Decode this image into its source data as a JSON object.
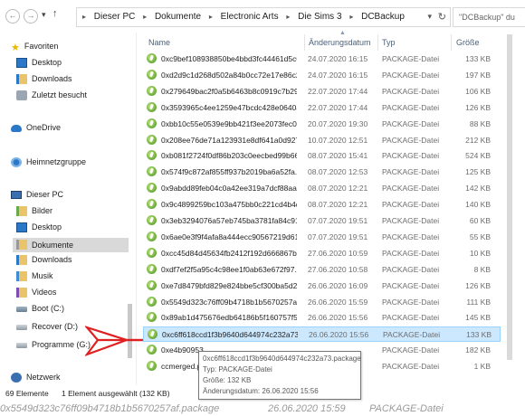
{
  "address_bar": {
    "crumbs": [
      "Dieser PC",
      "Dokumente",
      "Electronic Arts",
      "Die Sims 3",
      "DCBackup"
    ],
    "search_placeholder": "\"DCBackup\" du"
  },
  "sidebar": {
    "items": [
      {
        "label": "Favoriten",
        "icon": "star-icon"
      },
      {
        "label": "Desktop",
        "icon": "desktop-icon"
      },
      {
        "label": "Downloads",
        "icon": "downloads-icon"
      },
      {
        "label": "Zuletzt besucht",
        "icon": "recent-icon"
      },
      {
        "label": "OneDrive",
        "icon": "cloud-icon"
      },
      {
        "label": "Heimnetzgruppe",
        "icon": "homegroup-icon"
      },
      {
        "label": "Dieser PC",
        "icon": "computer-icon"
      },
      {
        "label": "Bilder",
        "icon": "pictures-icon"
      },
      {
        "label": "Desktop",
        "icon": "desktop-icon"
      },
      {
        "label": "Dokumente",
        "icon": "documents-icon"
      },
      {
        "label": "Downloads",
        "icon": "downloads-icon"
      },
      {
        "label": "Musik",
        "icon": "music-icon"
      },
      {
        "label": "Videos",
        "icon": "videos-icon"
      },
      {
        "label": "Boot (C:)",
        "icon": "drive-icon"
      },
      {
        "label": "Recover (D:)",
        "icon": "drive-icon"
      },
      {
        "label": "Programme (G:)",
        "icon": "drive-icon"
      },
      {
        "label": "Netzwerk",
        "icon": "network-icon"
      }
    ]
  },
  "columns": {
    "name": "Name",
    "date": "Änderungsdatum",
    "type": "Typ",
    "size": "Größe"
  },
  "files": [
    {
      "name": "0xc9bef108938850be4bbd3fc44461d5c0...",
      "date": "24.07.2020 16:15",
      "type": "PACKAGE-Datei",
      "size": "133 KB"
    },
    {
      "name": "0xd2d9c1d268d502a84b0cc72e17e86c2a...",
      "date": "24.07.2020 16:15",
      "type": "PACKAGE-Datei",
      "size": "197 KB"
    },
    {
      "name": "0x279649bac2f0a5b6463b8c0919c7b293...",
      "date": "22.07.2020 17:44",
      "type": "PACKAGE-Datei",
      "size": "106 KB"
    },
    {
      "name": "0x3593965c4ee1259e47bcdc428e0640a6...",
      "date": "22.07.2020 17:44",
      "type": "PACKAGE-Datei",
      "size": "126 KB"
    },
    {
      "name": "0xbb10c55e0539e9bb421f3ee2073fec08...",
      "date": "20.07.2020 19:30",
      "type": "PACKAGE-Datei",
      "size": "88 KB"
    },
    {
      "name": "0x208ee76de71a123931e8df641a0d9276...",
      "date": "10.07.2020 12:51",
      "type": "PACKAGE-Datei",
      "size": "212 KB"
    },
    {
      "name": "0xb081f2724f0df86b203c0eecbed99b66...",
      "date": "08.07.2020 15:41",
      "type": "PACKAGE-Datei",
      "size": "524 KB"
    },
    {
      "name": "0x574f9c872af855ff937b2019ba6a52fa.p...",
      "date": "08.07.2020 12:53",
      "type": "PACKAGE-Datei",
      "size": "125 KB"
    },
    {
      "name": "0x9abdd89feb04c0a42ee319a7dcf88aa7...",
      "date": "08.07.2020 12:21",
      "type": "PACKAGE-Datei",
      "size": "142 KB"
    },
    {
      "name": "0x9c4899259bc103a475bb0c221cd4b4d0...",
      "date": "08.07.2020 12:21",
      "type": "PACKAGE-Datei",
      "size": "140 KB"
    },
    {
      "name": "0x3eb3294076a57eb745ba3781fa84c91c...",
      "date": "07.07.2020 19:51",
      "type": "PACKAGE-Datei",
      "size": "60 KB"
    },
    {
      "name": "0x6ae0e3f9f4afa8a444ecc90567219d61.p...",
      "date": "07.07.2020 19:51",
      "type": "PACKAGE-Datei",
      "size": "55 KB"
    },
    {
      "name": "0xcc45d84d45634fb2412f192d666867b5...",
      "date": "27.06.2020 10:59",
      "type": "PACKAGE-Datei",
      "size": "10 KB"
    },
    {
      "name": "0xdf7ef2f5a95c4c98ee1f0ab63e672f97.p...",
      "date": "27.06.2020 10:58",
      "type": "PACKAGE-Datei",
      "size": "8 KB"
    },
    {
      "name": "0xe7d8479bfd829e824bbe5cf300ba5d26...",
      "date": "26.06.2020 16:09",
      "type": "PACKAGE-Datei",
      "size": "126 KB"
    },
    {
      "name": "0x5549d323c76ff09b4718b1b5670257af...",
      "date": "26.06.2020 15:59",
      "type": "PACKAGE-Datei",
      "size": "111 KB"
    },
    {
      "name": "0x89ab1d475676edb64186b5f160757f55...",
      "date": "26.06.2020 15:56",
      "type": "PACKAGE-Datei",
      "size": "145 KB"
    },
    {
      "name": "0xc6ff618ccd1f3b9640d644974c232a73.p...",
      "date": "26.06.2020 15:56",
      "type": "PACKAGE-Datei",
      "size": "133 KB",
      "selected": true
    },
    {
      "name": "0xe4b90953...",
      "date": "",
      "type": "PACKAGE-Datei",
      "size": "182 KB"
    },
    {
      "name": "ccmerged.p...",
      "date": "",
      "type": "PACKAGE-Datei",
      "size": "1 KB"
    }
  ],
  "tooltip": {
    "line1": "0xc6ff618ccd1f3b9640d644974c232a73.package",
    "line2": "Typ: PACKAGE-Datei",
    "line3": "Größe: 132 KB",
    "line4": "Änderungsdatum: 26.06.2020 15:56"
  },
  "status": {
    "count": "69 Elemente",
    "selection": "1 Element ausgewählt (132 KB)"
  },
  "ghost_row": {
    "name": "0x5549d323c76ff09b4718b1b5670257af.package",
    "date": "26.06.2020 15:59",
    "type": "PACKAGE-Datei"
  },
  "colors": {
    "selection_bg": "#cce8ff",
    "selection_border": "#99d1ff",
    "arrow": "#e02020",
    "header_text": "#4c607a"
  }
}
